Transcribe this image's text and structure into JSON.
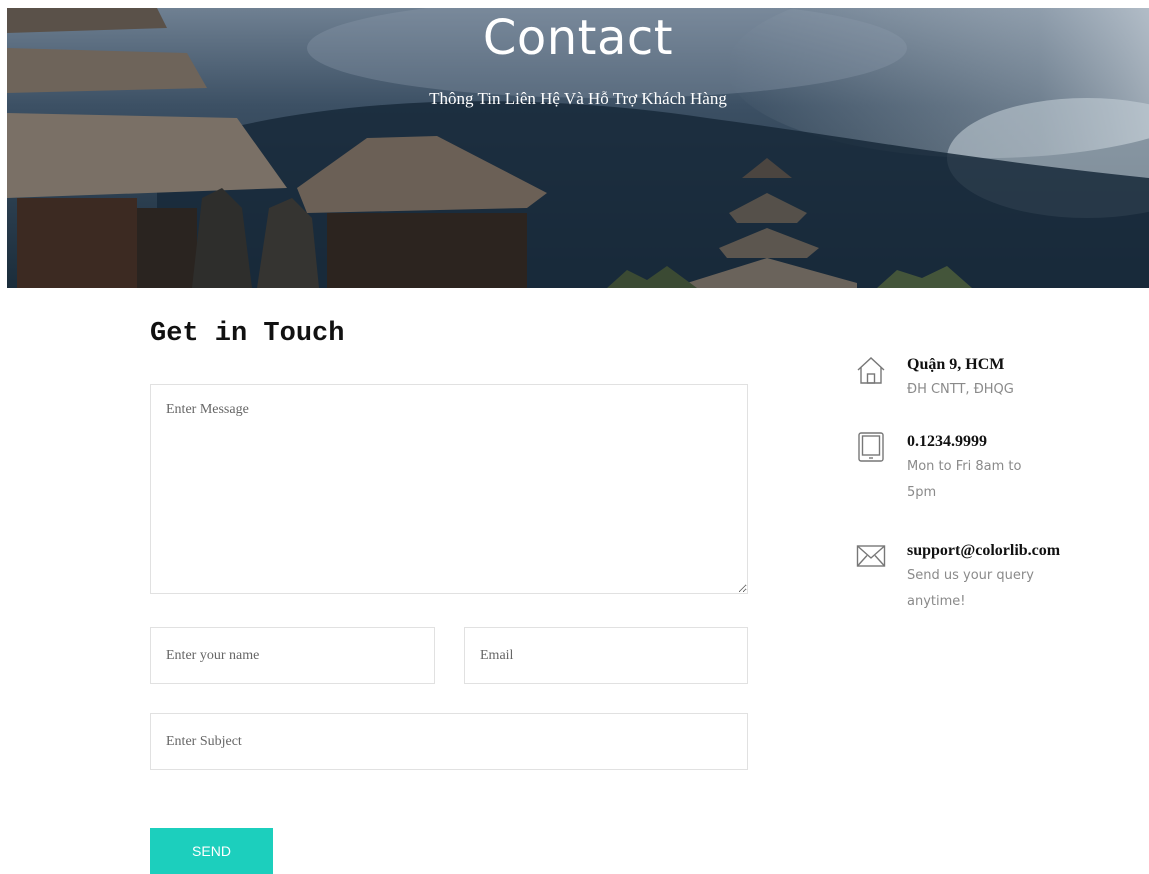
{
  "hero": {
    "title": "Contact",
    "subtitle": "Thông Tin Liên Hệ Và Hỗ Trợ Khách Hàng"
  },
  "form": {
    "title": "Get in Touch",
    "message_placeholder": "Enter Message",
    "name_placeholder": "Enter your name",
    "email_placeholder": "Email",
    "subject_placeholder": "Enter Subject",
    "send_label": "SEND"
  },
  "info": {
    "address": {
      "icon": "home-icon",
      "heading": "Quận 9, HCM",
      "desc": "ĐH CNTT, ĐHQG"
    },
    "phone": {
      "icon": "tablet-icon",
      "heading": "0.1234.9999",
      "desc": "Mon to Fri 8am to 5pm"
    },
    "email": {
      "icon": "envelope-icon",
      "heading": "support@colorlib.com",
      "desc": "Send us your query anytime!"
    }
  },
  "colors": {
    "accent": "#1ccfbd",
    "border": "#e1e1e1",
    "muted_text": "#8a8a8a"
  }
}
